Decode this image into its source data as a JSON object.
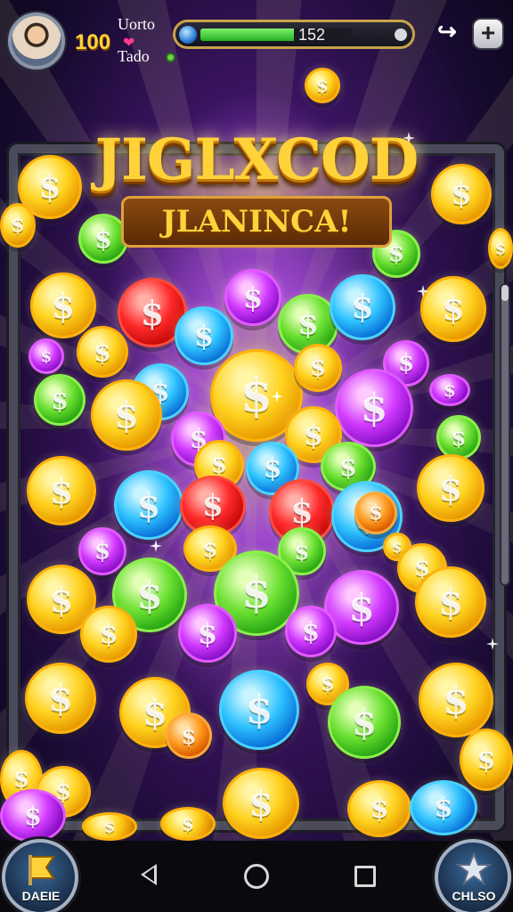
{
  "player": {
    "level": "100",
    "name": "Uorto",
    "status": "Tado"
  },
  "xp": {
    "value": "152",
    "fill_fraction": 0.62
  },
  "header_buttons": {
    "exit_icon": "exit-door-icon",
    "plus_icon": "plus-icon"
  },
  "title": {
    "main": "JIGLXCOD",
    "sub": "JLANINCA!"
  },
  "bottom": {
    "left_button_label": "DAEIE",
    "right_button_label": "CHLSO"
  },
  "colors": {
    "gold": "#ffd21e",
    "xp_fill": "#3cc22c",
    "frame": "#4a4a5a"
  }
}
